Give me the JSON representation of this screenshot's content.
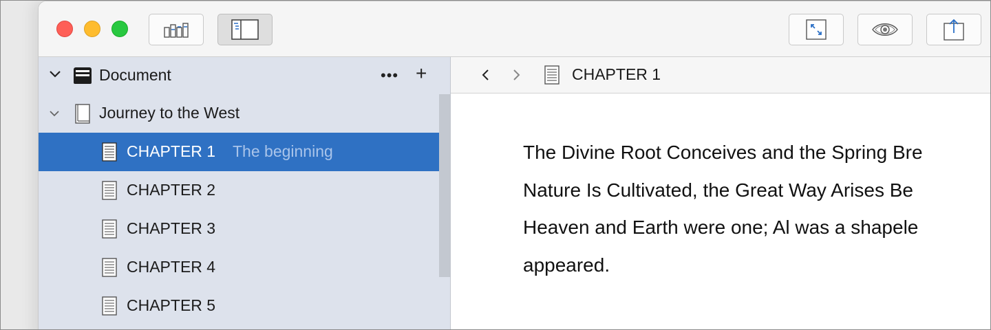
{
  "toolbar": {
    "buttons": [
      {
        "name": "corkboard-view",
        "icon": "corkboard-icon",
        "active": false
      },
      {
        "name": "toggle-binder",
        "icon": "sidebar-icon",
        "active": true
      },
      {
        "name": "composition-mode",
        "icon": "expand-icon",
        "active": false
      },
      {
        "name": "quick-look",
        "icon": "eye-icon",
        "active": false
      },
      {
        "name": "share",
        "icon": "share-icon",
        "active": false
      }
    ]
  },
  "sidebar": {
    "header": {
      "title": "Document",
      "more_label": "•••",
      "add_label": "+"
    },
    "book": {
      "title": "Journey to the West"
    },
    "items": [
      {
        "label": "CHAPTER 1",
        "subtitle": "The beginning",
        "selected": true
      },
      {
        "label": "CHAPTER 2",
        "subtitle": "",
        "selected": false
      },
      {
        "label": "CHAPTER 3",
        "subtitle": "",
        "selected": false
      },
      {
        "label": "CHAPTER 4",
        "subtitle": "",
        "selected": false
      },
      {
        "label": "CHAPTER 5",
        "subtitle": "",
        "selected": false
      }
    ]
  },
  "editor": {
    "breadcrumb": "CHAPTER 1",
    "lines": [
      "The Divine Root Conceives and the Spring Bre",
      "Nature Is Cultivated, the Great Way Arises Be",
      "Heaven and Earth were one; Al was a shapele",
      "appeared."
    ]
  },
  "colors": {
    "selection": "#2f71c3",
    "sidebar_bg": "#dde2ec",
    "accent_blue": "#2a6fc6"
  }
}
